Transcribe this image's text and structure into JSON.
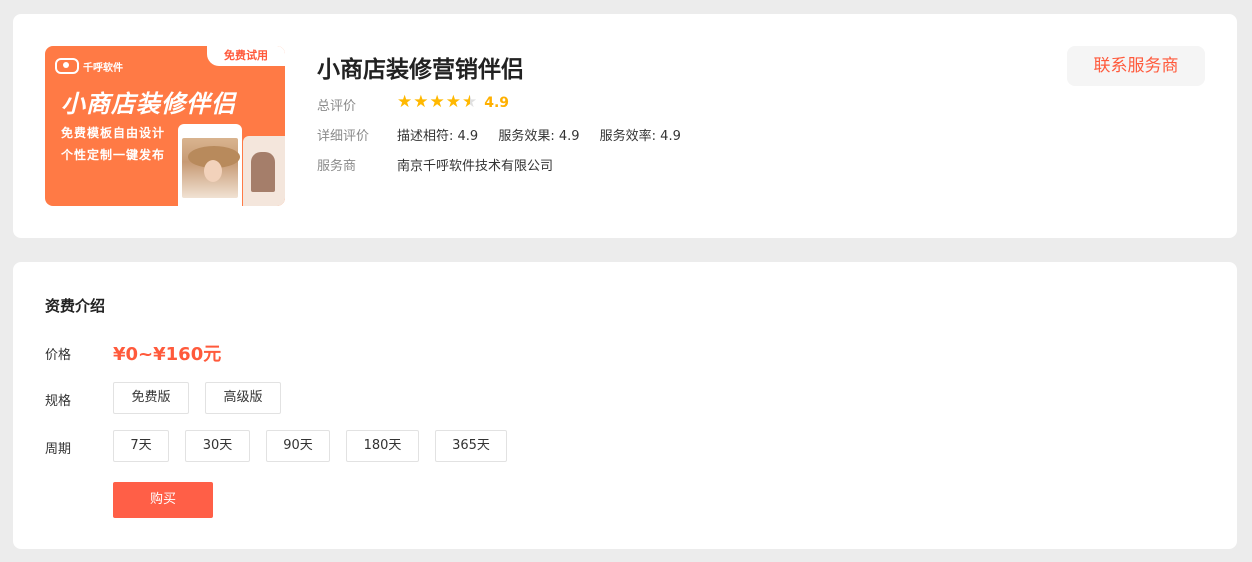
{
  "product": {
    "banner": {
      "tag": "免费试用",
      "brand": "千呼软件",
      "headline": "小商店装修伴侣",
      "line1": "免费模板自由设计",
      "line2": "个性定制一键发布"
    },
    "title": "小商店装修营销伴侣",
    "rating_label": "总评价",
    "rating": 4.9,
    "rating_text": "4.9",
    "detail_label": "详细评价",
    "detail": [
      "描述相符: 4.9",
      "服务效果: 4.9",
      "服务效率: 4.9"
    ],
    "provider_label": "服务商",
    "provider": "南京千呼软件技术有限公司",
    "contact_button": "联系服务商"
  },
  "pricing": {
    "section_title": "资费介绍",
    "price_label": "价格",
    "price": "¥0~¥160元",
    "spec_label": "规格",
    "specs": [
      "免费版",
      "高级版"
    ],
    "period_label": "周期",
    "periods": [
      "7天",
      "30天",
      "90天",
      "180天",
      "365天"
    ],
    "buy_button": "购买"
  },
  "colors": {
    "accent": "#ff5a3c",
    "star": "#ffb800",
    "banner_bg": "#ff7a45"
  }
}
